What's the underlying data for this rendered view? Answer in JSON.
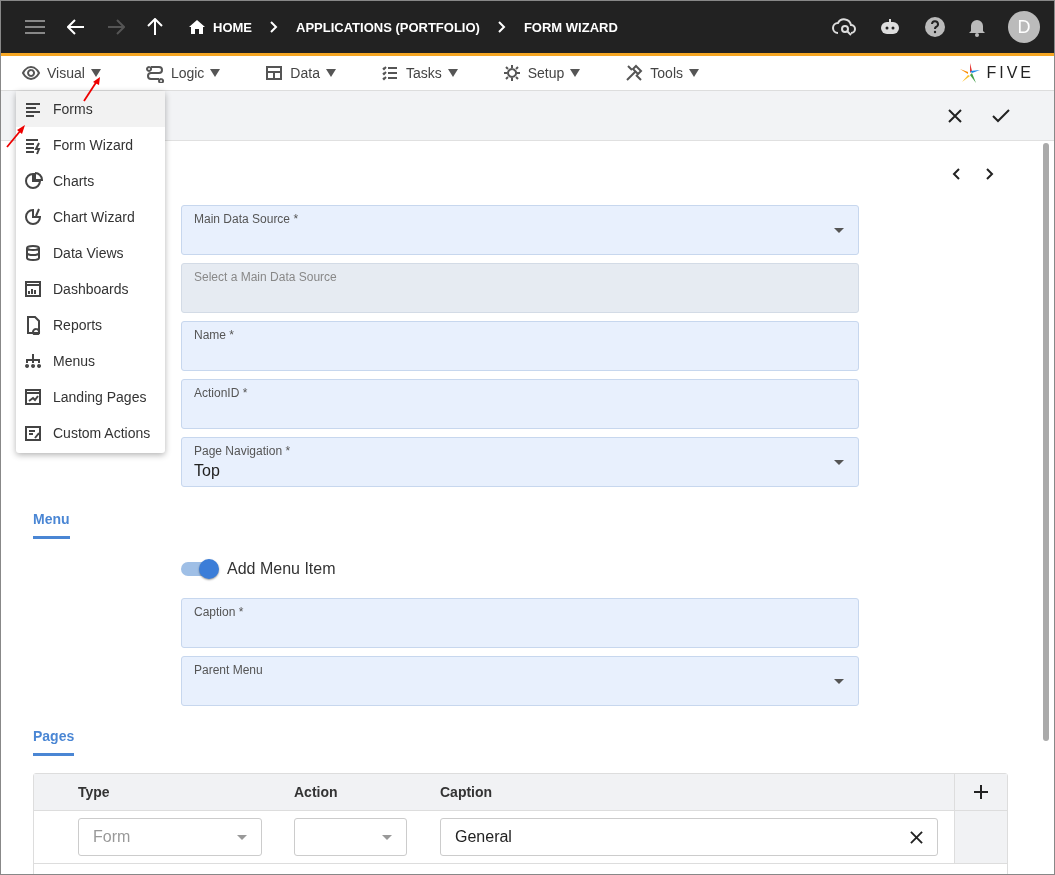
{
  "topbar": {
    "breadcrumbs": [
      "HOME",
      "APPLICATIONS (PORTFOLIO)",
      "FORM WIZARD"
    ],
    "avatar": "D"
  },
  "menubar": {
    "items": [
      {
        "label": "Visual"
      },
      {
        "label": "Logic"
      },
      {
        "label": "Data"
      },
      {
        "label": "Tasks"
      },
      {
        "label": "Setup"
      },
      {
        "label": "Tools"
      }
    ],
    "logo": "FIVE"
  },
  "dropdown": {
    "items": [
      {
        "label": "Forms",
        "selected": true
      },
      {
        "label": "Form Wizard",
        "selected": false
      },
      {
        "label": "Charts",
        "selected": false
      },
      {
        "label": "Chart Wizard",
        "selected": false
      },
      {
        "label": "Data Views",
        "selected": false
      },
      {
        "label": "Dashboards",
        "selected": false
      },
      {
        "label": "Reports",
        "selected": false
      },
      {
        "label": "Menus",
        "selected": false
      },
      {
        "label": "Landing Pages",
        "selected": false
      },
      {
        "label": "Custom Actions",
        "selected": false
      }
    ]
  },
  "fields": [
    {
      "kind": "select",
      "label": "Main Data Source *",
      "disabled": false
    },
    {
      "kind": "text",
      "placeholder": "Select a Main Data Source",
      "disabled": true
    },
    {
      "kind": "text",
      "label": "Name *",
      "disabled": false
    },
    {
      "kind": "text",
      "label": "ActionID *",
      "disabled": false
    },
    {
      "kind": "select",
      "label": "Page Navigation *",
      "value": "Top",
      "disabled": false
    }
  ],
  "menu_section": {
    "title": "Menu",
    "toggle": {
      "label": "Add Menu Item",
      "on": true
    },
    "fields": [
      {
        "kind": "text",
        "label": "Caption *",
        "disabled": false
      },
      {
        "kind": "select",
        "label": "Parent Menu",
        "disabled": false
      }
    ]
  },
  "pages_section": {
    "title": "Pages",
    "table": {
      "columns": [
        "Type",
        "Action",
        "Caption"
      ],
      "rows": [
        {
          "type": {
            "placeholder": "Form"
          },
          "action": {},
          "caption": "General"
        }
      ]
    }
  }
}
